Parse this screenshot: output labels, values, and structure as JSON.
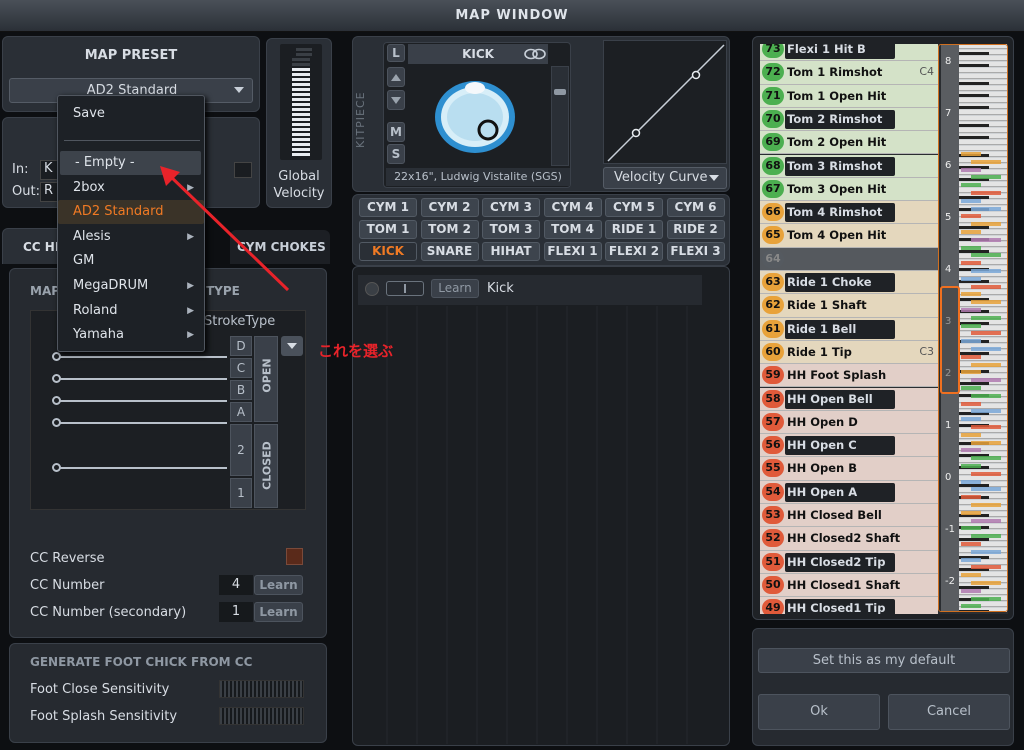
{
  "window": {
    "title": "MAP WINDOW"
  },
  "preset": {
    "heading": "MAP PRESET",
    "selected": "AD2 Standard",
    "in_label": "In:",
    "out_label": "Out:",
    "in_partial": "K",
    "out_partial": "R"
  },
  "global_velocity": {
    "label": "Global Velocity",
    "level": 0.85
  },
  "preset_menu": {
    "items": [
      {
        "label": "Save",
        "submenu": false
      },
      {
        "label": "- Empty -",
        "submenu": false,
        "highlighted": true
      },
      {
        "label": "2box",
        "submenu": true
      },
      {
        "label": "AD2 Standard",
        "submenu": false,
        "selected": true
      },
      {
        "label": "Alesis",
        "submenu": true
      },
      {
        "label": "GM",
        "submenu": false
      },
      {
        "label": "MegaDRUM",
        "submenu": true
      },
      {
        "label": "Roland",
        "submenu": true
      },
      {
        "label": "Yamaha",
        "submenu": true
      }
    ]
  },
  "annotation": {
    "text": "これを選ぶ",
    "color": "#e8232a"
  },
  "tabs": {
    "cc_hh": "CC HH",
    "cym_chokes": "CYM CHOKES"
  },
  "cc_section": {
    "title_left": "MAP",
    "title_right": "TYPE",
    "stroke_type": "StrokeType",
    "zones_open": [
      "D",
      "C",
      "B",
      "A"
    ],
    "zones_closed": [
      "2",
      "1"
    ],
    "open_label": "OPEN",
    "closed_label": "CLOSED",
    "cc_reverse": "CC Reverse",
    "cc_number_label": "CC Number",
    "cc_number_value": "4",
    "cc_number_secondary_label": "CC Number (secondary)",
    "cc_number_secondary_value": "1",
    "learn": "Learn"
  },
  "foot_chick": {
    "title": "GENERATE FOOT CHICK FROM CC",
    "close": "Foot Close Sensitivity",
    "splash": "Foot Splash Sensitivity"
  },
  "kitpiece": {
    "side_label": "KITPIECE",
    "name": "KICK",
    "description": "22x16\", Ludwig Vistalite (SGS)",
    "buttons": [
      "L",
      "M",
      "S"
    ],
    "velocity_curve": "Velocity Curve"
  },
  "pads": [
    "CYM 1",
    "CYM 2",
    "CYM 3",
    "CYM 4",
    "CYM 5",
    "CYM 6",
    "TOM 1",
    "TOM 2",
    "TOM 3",
    "TOM 4",
    "RIDE 1",
    "RIDE 2",
    "KICK",
    "SNARE",
    "HIHAT",
    "FLEXI 1",
    "FLEXI 2",
    "FLEXI 3"
  ],
  "active_pad": "KICK",
  "trigger": {
    "learn": "Learn",
    "name": "Kick"
  },
  "notes": [
    {
      "num": "73",
      "label": "Flexi 1 Hit B",
      "color": "#4caf50",
      "dark": true
    },
    {
      "num": "72",
      "label": "Tom 1 Rimshot",
      "color": "#4caf50",
      "dark": false,
      "tag": "C4"
    },
    {
      "num": "71",
      "label": "Tom 1 Open Hit",
      "color": "#4caf50",
      "dark": false
    },
    {
      "num": "70",
      "label": "Tom 2 Rimshot",
      "color": "#4caf50",
      "dark": true
    },
    {
      "num": "69",
      "label": "Tom 2 Open Hit",
      "color": "#4caf50",
      "dark": false
    },
    {
      "num": "68",
      "label": "Tom 3 Rimshot",
      "color": "#4caf50",
      "dark": true
    },
    {
      "num": "67",
      "label": "Tom 3 Open Hit",
      "color": "#4caf50",
      "dark": false
    },
    {
      "num": "66",
      "label": "Tom 4 Rimshot",
      "color": "#e8a23a",
      "dark": true
    },
    {
      "num": "65",
      "label": "Tom 4 Open Hit",
      "color": "#e8a23a",
      "dark": false
    },
    {
      "num": "64",
      "label": "",
      "color": "#555a60",
      "dark": true,
      "empty": true
    },
    {
      "num": "63",
      "label": "Ride 1 Choke",
      "color": "#e8a23a",
      "dark": true
    },
    {
      "num": "62",
      "label": "Ride 1 Shaft",
      "color": "#e8a23a",
      "dark": false
    },
    {
      "num": "61",
      "label": "Ride 1 Bell",
      "color": "#e8a23a",
      "dark": true
    },
    {
      "num": "60",
      "label": "Ride 1 Tip",
      "color": "#e8a23a",
      "dark": false,
      "tag": "C3"
    },
    {
      "num": "59",
      "label": "HH Foot Splash",
      "color": "#e05a3a",
      "dark": false
    },
    {
      "num": "58",
      "label": "HH Open Bell",
      "color": "#e05a3a",
      "dark": true
    },
    {
      "num": "57",
      "label": "HH Open D",
      "color": "#e05a3a",
      "dark": false
    },
    {
      "num": "56",
      "label": "HH Open C",
      "color": "#e05a3a",
      "dark": true
    },
    {
      "num": "55",
      "label": "HH Open B",
      "color": "#e05a3a",
      "dark": false
    },
    {
      "num": "54",
      "label": "HH Open A",
      "color": "#e05a3a",
      "dark": true
    },
    {
      "num": "53",
      "label": "HH Closed Bell",
      "color": "#e05a3a",
      "dark": false
    },
    {
      "num": "52",
      "label": "HH Closed2 Shaft",
      "color": "#e05a3a",
      "dark": false
    },
    {
      "num": "51",
      "label": "HH Closed2 Tip",
      "color": "#e05a3a",
      "dark": true
    },
    {
      "num": "50",
      "label": "HH Closed1 Shaft",
      "color": "#e05a3a",
      "dark": false
    },
    {
      "num": "49",
      "label": "HH Closed1 Tip",
      "color": "#e05a3a",
      "dark": true
    }
  ],
  "octaves": [
    "8",
    "7",
    "6",
    "5",
    "4",
    "3",
    "2",
    "1",
    "0",
    "-1",
    "-2"
  ],
  "footer": {
    "default": "Set this as my default",
    "ok": "Ok",
    "cancel": "Cancel"
  }
}
